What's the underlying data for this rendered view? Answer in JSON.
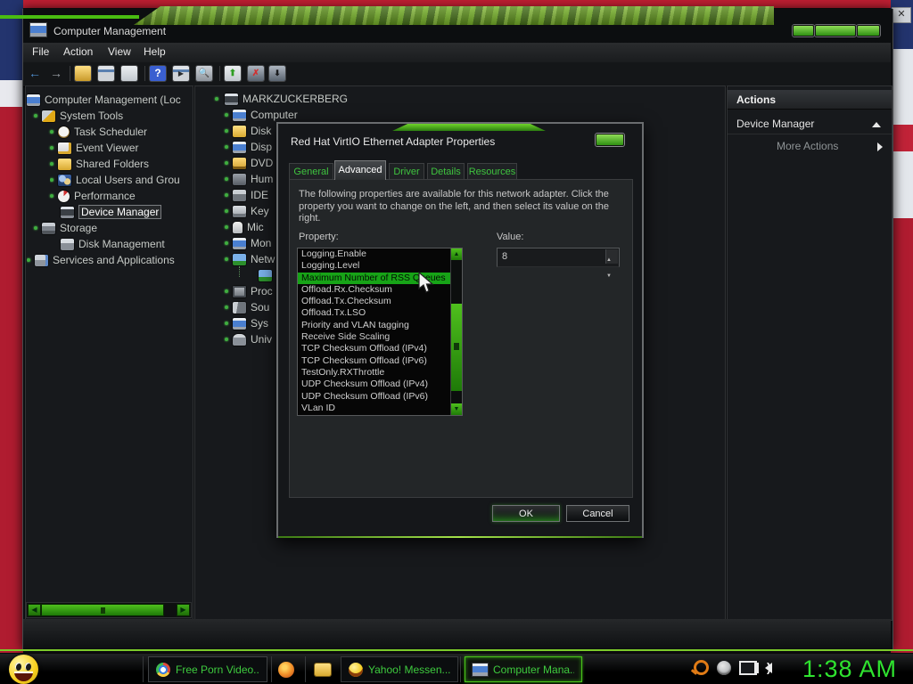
{
  "window": {
    "title": "Computer Management",
    "menu": [
      {
        "label": "File"
      },
      {
        "label": "Action"
      },
      {
        "label": "View"
      },
      {
        "label": "Help"
      }
    ],
    "toolbar_icons": [
      "back-icon",
      "forward-icon",
      "show-console-tree-icon",
      "console-window-icon",
      "properties-icon",
      "help-icon",
      "show-action-pane-icon",
      "scan-hardware-icon",
      "export-list-icon",
      "disable-device-icon",
      "update-driver-icon"
    ]
  },
  "left_tree": {
    "items": [
      {
        "label": "Computer Management (Loc",
        "icon": "computer-management-icon"
      },
      {
        "label": "System Tools",
        "icon": "system-tools-icon"
      },
      {
        "label": "Task Scheduler",
        "icon": "task-scheduler-icon"
      },
      {
        "label": "Event Viewer",
        "icon": "event-viewer-icon"
      },
      {
        "label": "Shared Folders",
        "icon": "shared-folders-icon"
      },
      {
        "label": "Local Users and Grou",
        "icon": "local-users-icon"
      },
      {
        "label": "Performance",
        "icon": "performance-icon"
      },
      {
        "label": "Device Manager",
        "icon": "device-manager-icon",
        "selected": true
      },
      {
        "label": "Storage",
        "icon": "storage-icon"
      },
      {
        "label": "Disk Management",
        "icon": "disk-management-icon"
      },
      {
        "label": "Services and Applications",
        "icon": "services-icon"
      }
    ]
  },
  "center_tree": {
    "items": [
      {
        "label": "MARKZUCKERBERG",
        "icon": "computer-icon"
      },
      {
        "label": "Computer",
        "icon": "computer-icon"
      },
      {
        "label": "Disk",
        "icon": "disk-drives-icon"
      },
      {
        "label": "Disp",
        "icon": "display-adapters-icon"
      },
      {
        "label": "DVD",
        "icon": "dvd-drive-icon"
      },
      {
        "label": "Hum",
        "icon": "hid-icon"
      },
      {
        "label": "IDE",
        "icon": "ide-controllers-icon"
      },
      {
        "label": "Key",
        "icon": "keyboard-icon"
      },
      {
        "label": "Mic",
        "icon": "mouse-icon"
      },
      {
        "label": "Mon",
        "icon": "monitor-icon"
      },
      {
        "label": "Netw",
        "icon": "network-adapter-icon"
      },
      {
        "label": "",
        "icon": "network-adapter-icon"
      },
      {
        "label": "Proc",
        "icon": "processor-icon"
      },
      {
        "label": "Sou",
        "icon": "sound-icon"
      },
      {
        "label": "Sys",
        "icon": "system-devices-icon"
      },
      {
        "label": "Univ",
        "icon": "usb-icon"
      }
    ]
  },
  "actions_panel": {
    "header": "Actions",
    "section": "Device Manager",
    "more_actions": "More Actions"
  },
  "dialog": {
    "title": "Red Hat VirtIO Ethernet Adapter Properties",
    "tabs": [
      {
        "label": "General"
      },
      {
        "label": "Advanced",
        "selected": true
      },
      {
        "label": "Driver"
      },
      {
        "label": "Details"
      },
      {
        "label": "Resources"
      }
    ],
    "description": "The following properties are available for this network adapter. Click the property you want to change on the left, and then select its value on the right.",
    "property_label": "Property:",
    "value_label": "Value:",
    "properties": [
      "Logging.Enable",
      "Logging.Level",
      "Maximum Number of RSS Queues",
      "Offload.Rx.Checksum",
      "Offload.Tx.Checksum",
      "Offload.Tx.LSO",
      "Priority and VLAN tagging",
      "Receive Side Scaling",
      "TCP Checksum Offload (IPv4)",
      "TCP Checksum Offload (IPv6)",
      "TestOnly.RXThrottle",
      "UDP Checksum Offload (IPv4)",
      "UDP Checksum Offload (IPv6)",
      "VLan ID"
    ],
    "selected_property_index": 2,
    "value": "8",
    "buttons": {
      "ok": "OK",
      "cancel": "Cancel"
    }
  },
  "taskbar": {
    "start_icon": "smiley-start-icon",
    "buttons": [
      {
        "label": "Free Porn Video...",
        "icon": "chrome-icon"
      },
      {
        "label": "Yahoo! Messen...",
        "icon": "yahoo-messenger-icon"
      },
      {
        "label": "Computer Mana...",
        "icon": "computer-icon",
        "active": true
      }
    ],
    "quick_launch": [
      "firefox-icon",
      "folder-icon"
    ],
    "tray_icons": [
      "search-tray-icon",
      "messenger-tray-icon",
      "network-tray-icon",
      "volume-tray-icon"
    ],
    "clock": "1:38 AM"
  },
  "colors": {
    "accent_green": "#2ecb2e",
    "selection_green": "#17a317",
    "tab_text_green": "#3fc43f",
    "taskbar_text_green": "#3ecb3e",
    "flag_red": "#b01c30",
    "flag_blue": "#23346e"
  }
}
